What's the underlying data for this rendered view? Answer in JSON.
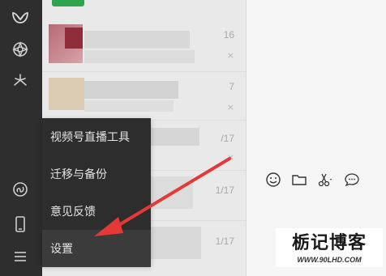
{
  "app": "WeChat",
  "sidebar": {
    "icons": [
      "wechat-logo-icon",
      "moments-icon",
      "discover-icon",
      "mini-programs-icon",
      "phone-icon",
      "menu-icon"
    ]
  },
  "chat_list": {
    "rows": [
      {
        "time": "16",
        "muted": true
      },
      {
        "time": "7",
        "muted": true
      },
      {
        "time": "/17",
        "muted": true
      },
      {
        "time": "1/17",
        "muted": false
      },
      {
        "time": "1/17",
        "muted": false
      }
    ]
  },
  "menu": {
    "items": [
      {
        "label": "视频号直播工具"
      },
      {
        "label": "迁移与备份"
      },
      {
        "label": "意见反馈"
      },
      {
        "label": "设置"
      }
    ],
    "highlighted": "设置"
  },
  "toolbar": {
    "icons": [
      "emoji-icon",
      "folder-icon",
      "scissors-icon",
      "chat-bubble-icon"
    ]
  },
  "annotation": {
    "arrow_color": "#e53935"
  },
  "watermark": {
    "title": "栃记博客",
    "url": "WWW.90LHD.COM"
  },
  "colors": {
    "sidebar_bg": "#2e2e2e",
    "menu_bg": "#2d2d2d",
    "list_bg": "#e9e9e9",
    "chat_bg": "#f5f5f5"
  }
}
